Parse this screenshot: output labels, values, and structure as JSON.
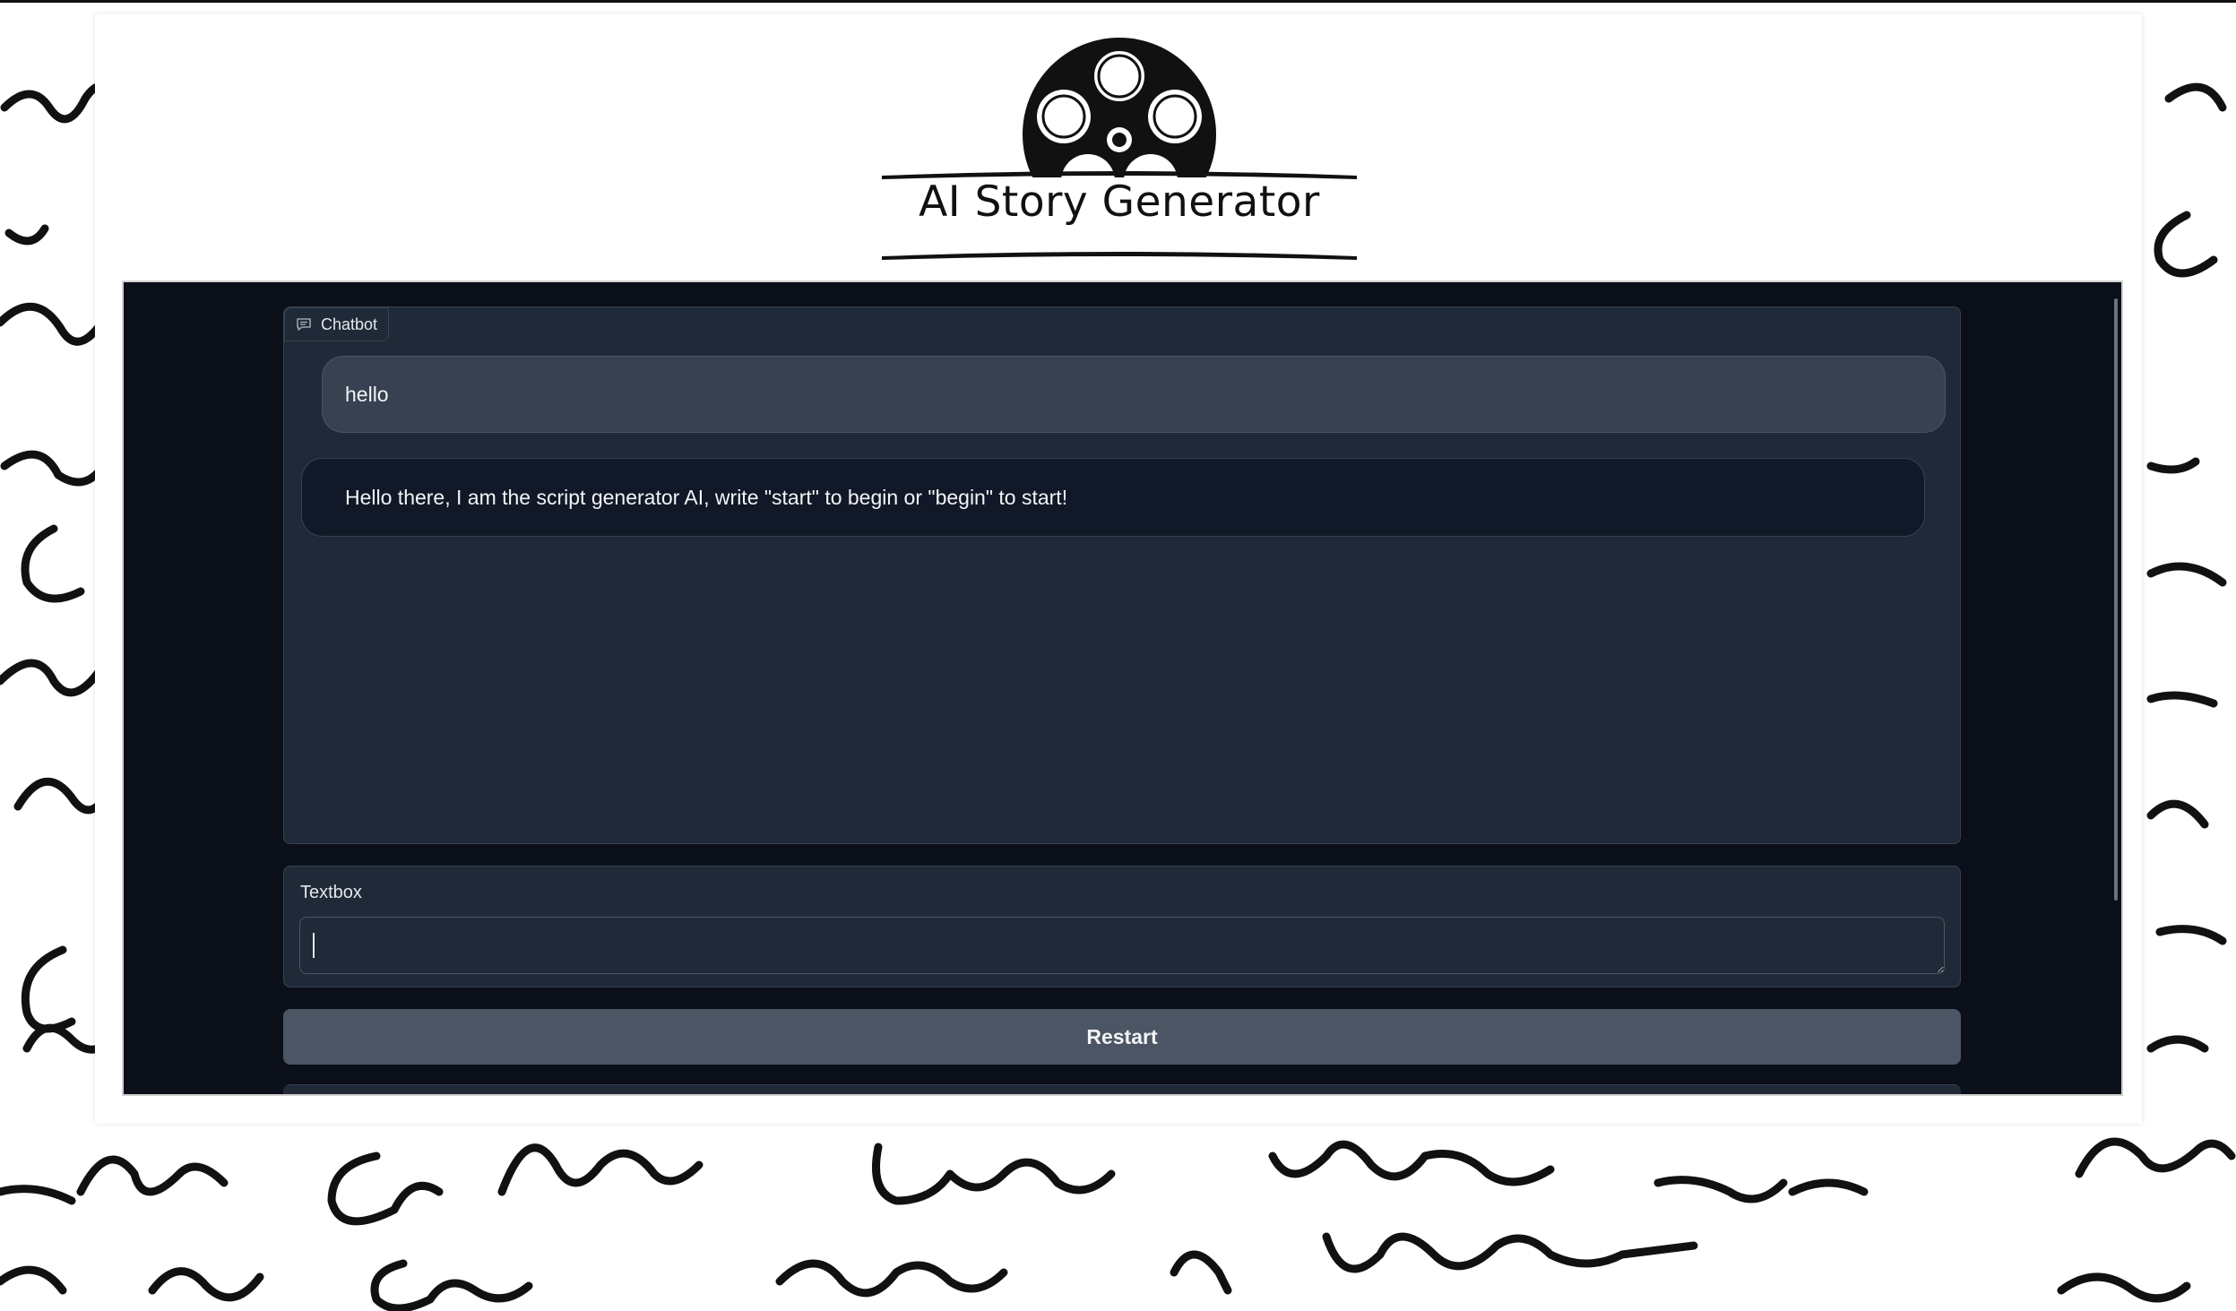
{
  "header": {
    "logo_title": "AI Story Generator"
  },
  "chatbot": {
    "label": "Chatbot",
    "label_icon": "chat-bubble-icon",
    "messages": [
      {
        "role": "user",
        "text": "hello"
      },
      {
        "role": "bot",
        "text": "Hello there, I am the script generator AI, write \"start\" to begin or \"begin\" to start!"
      }
    ]
  },
  "textbox": {
    "label": "Textbox",
    "value": ""
  },
  "restart_button": {
    "label": "Restart"
  },
  "colors": {
    "app_background": "#0b0f19",
    "panel": "#1f2937",
    "user_bubble": "#374151",
    "bot_bubble": "#111827",
    "button": "#4b5563"
  }
}
